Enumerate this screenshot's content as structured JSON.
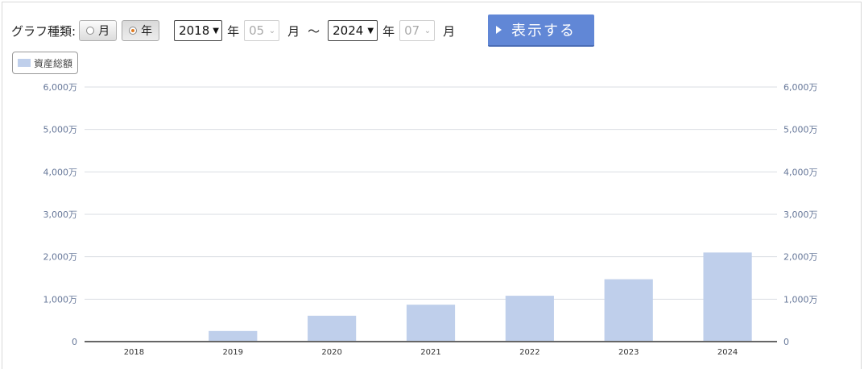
{
  "toolbar": {
    "graph_type_label": "グラフ種類:",
    "radio_month": "月",
    "radio_year": "年",
    "start_year": "2018",
    "start_year_unit": "年",
    "start_month": "05",
    "start_month_unit": "月",
    "range_sep": "～",
    "end_year": "2024",
    "end_year_unit": "年",
    "end_month": "07",
    "end_month_unit": "月",
    "show_label": "表示する"
  },
  "chart_data": {
    "type": "bar",
    "categories": [
      "2018",
      "2019",
      "2020",
      "2021",
      "2022",
      "2023",
      "2024"
    ],
    "series": [
      {
        "name": "資産総額",
        "values": [
          0,
          250,
          610,
          870,
          1080,
          1470,
          2100
        ],
        "color": "#bfcfeb"
      }
    ],
    "ylim": [
      0,
      6000
    ],
    "yticks": [
      "0",
      "1,000万",
      "2,000万",
      "3,000万",
      "4,000万",
      "5,000万",
      "6,000万"
    ],
    "grid": true,
    "legend": "top-left"
  }
}
